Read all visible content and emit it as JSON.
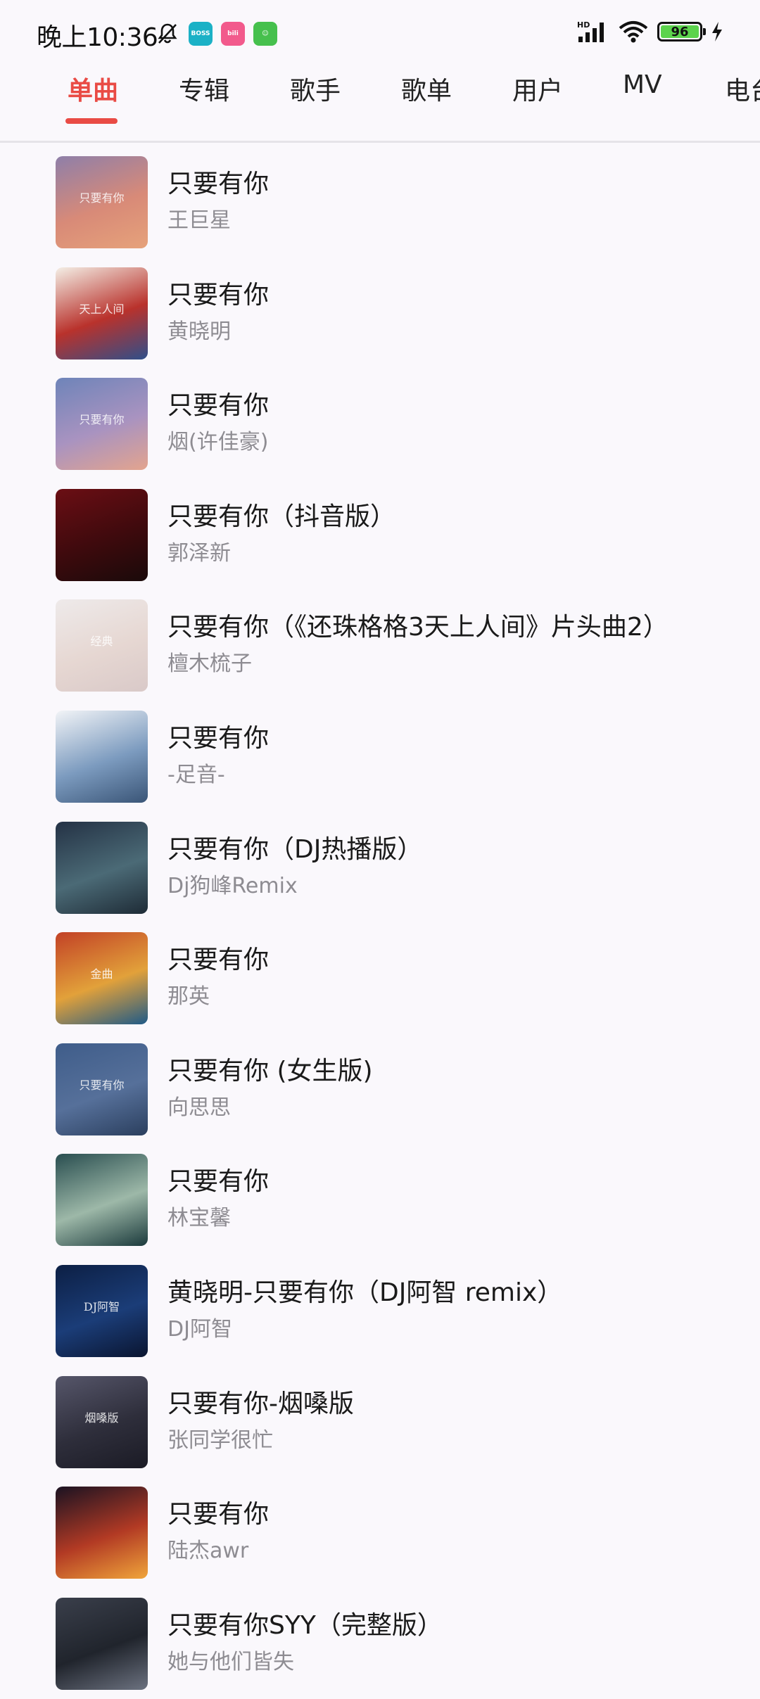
{
  "status_bar": {
    "time": "晚上10:36",
    "battery": "96",
    "network_label": "HD"
  },
  "tabs": [
    "单曲",
    "专辑",
    "歌手",
    "歌单",
    "用户",
    "MV",
    "电台"
  ],
  "songs": [
    {
      "title": "只要有你",
      "artist": "王巨星"
    },
    {
      "title": "只要有你",
      "artist": "黄晓明"
    },
    {
      "title": "只要有你",
      "artist": "烟(许佳豪)"
    },
    {
      "title": "只要有你（抖音版）",
      "artist": "郭泽新"
    },
    {
      "title": "只要有你（《还珠格格3天上人间》片头曲2）",
      "artist": "檀木梳子"
    },
    {
      "title": "只要有你",
      "artist": "-足音-"
    },
    {
      "title": "只要有你（DJ热播版）",
      "artist": "Dj狗峰Remix"
    },
    {
      "title": "只要有你",
      "artist": "那英"
    },
    {
      "title": "只要有你 (女生版)",
      "artist": "向思思"
    },
    {
      "title": "只要有你",
      "artist": "林宝馨"
    },
    {
      "title": "黄晓明-只要有你（DJ阿智 remix）",
      "artist": "DJ阿智"
    },
    {
      "title": "只要有你-烟嗓版",
      "artist": "张同学很忙"
    },
    {
      "title": "只要有你",
      "artist": "陆杰awr"
    },
    {
      "title": "只要有你SYY（完整版）",
      "artist": "她与他们皆失"
    }
  ],
  "covers": [
    {
      "colors": [
        "#8E7FA9",
        "#D88A78",
        "#E6A27A"
      ],
      "text": "只要有你"
    },
    {
      "colors": [
        "#F4EFE6",
        "#B9322C",
        "#2F4F8A"
      ],
      "text": "天上人间"
    },
    {
      "colors": [
        "#6E84B9",
        "#A993C0",
        "#E3A48E"
      ],
      "text": "只要有你"
    },
    {
      "colors": [
        "#6B0E14",
        "#3E0A0D",
        "#1A0A0A"
      ],
      "text": ""
    },
    {
      "colors": [
        "#EEEAEA",
        "#E6D7D2",
        "#D9C9C8"
      ],
      "text": "经典"
    },
    {
      "colors": [
        "#F2F4F7",
        "#7C9BBF",
        "#3A5577"
      ],
      "text": ""
    },
    {
      "colors": [
        "#243245",
        "#4B6A76",
        "#1E2B36"
      ],
      "text": ""
    },
    {
      "colors": [
        "#C24126",
        "#E2A13A",
        "#1F5A87"
      ],
      "text": "金曲"
    },
    {
      "colors": [
        "#3F5D8A",
        "#56709A",
        "#2B3F5E"
      ],
      "text": "只要有你"
    },
    {
      "colors": [
        "#294E50",
        "#9DB8A8",
        "#1B3A3C"
      ],
      "text": ""
    },
    {
      "colors": [
        "#0C1F44",
        "#1B3D78",
        "#0A1530"
      ],
      "text": "DJ阿智"
    },
    {
      "colors": [
        "#56566A",
        "#2E2E3B",
        "#1B1B25"
      ],
      "text": "烟嗓版"
    },
    {
      "colors": [
        "#1A1222",
        "#B23A24",
        "#F0A53A"
      ],
      "text": ""
    },
    {
      "colors": [
        "#3A3F4B",
        "#20242C",
        "#6C7280"
      ],
      "text": ""
    }
  ]
}
